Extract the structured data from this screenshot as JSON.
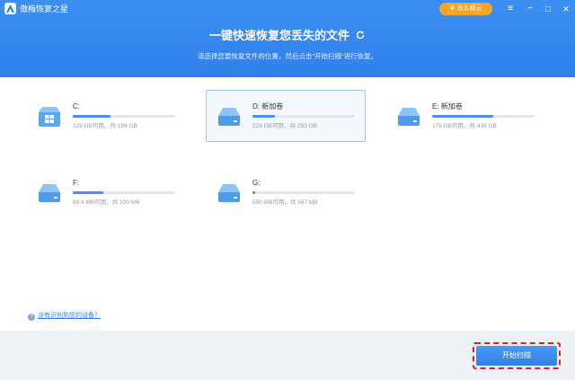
{
  "app": {
    "name": "傲梅恢复之星",
    "vip_label": "永久精云",
    "controls": [
      "≡",
      "−",
      "□",
      "✕"
    ]
  },
  "header": {
    "title": "一键快速恢复您丢失的文件",
    "subtitle": "请选择您要恢复文件的位置，然后点击\"开始扫描\"进行恢复。"
  },
  "drives": [
    {
      "name": "C:",
      "size": "125 GB可用，共 198 GB",
      "used_fraction": 0.37,
      "icon": "windows-drive-icon",
      "selected": false
    },
    {
      "name": "D: 新加卷",
      "size": "229 GB可用，共 292 GB",
      "used_fraction": 0.22,
      "icon": "disk-drive-icon",
      "selected": true
    },
    {
      "name": "E: 新加卷",
      "size": "175 GB可用，共 439 GB",
      "used_fraction": 0.6,
      "icon": "disk-drive-icon",
      "selected": false
    },
    {
      "name": "F:",
      "size": "69.4 MB可用，共 100 MB",
      "used_fraction": 0.3,
      "icon": "disk-drive-icon",
      "selected": false
    },
    {
      "name": "G:",
      "size": "550 MB可用，共 567 MB",
      "used_fraction": 0.03,
      "icon": "disk-drive-icon",
      "selected": false
    }
  ],
  "help": {
    "label": "没有识别到您的设备？"
  },
  "footer": {
    "start_label": "开始扫描"
  },
  "colors": {
    "accent": "#2f80ea",
    "vip": "#f7a528",
    "highlight": "#e0211b"
  }
}
